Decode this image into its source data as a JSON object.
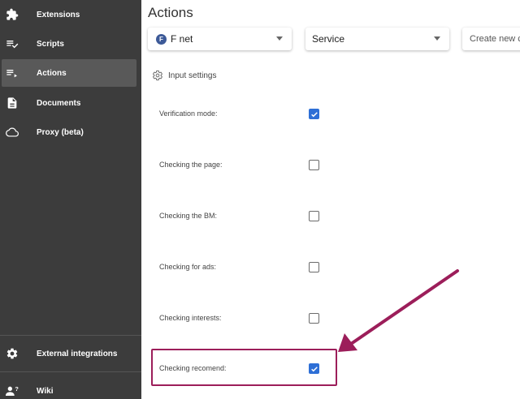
{
  "sidebar": {
    "items": [
      {
        "label": "Extensions",
        "icon": "puzzle-icon"
      },
      {
        "label": "Scripts",
        "icon": "playlist-check-icon"
      },
      {
        "label": "Actions",
        "icon": "playlist-play-icon",
        "active": true
      },
      {
        "label": "Documents",
        "icon": "document-icon"
      },
      {
        "label": "Proxy (beta)",
        "icon": "cloud-icon"
      }
    ],
    "bottom_items": [
      {
        "label": "External integrations",
        "icon": "gear-icon"
      },
      {
        "label": "Wiki",
        "icon": "person-help-icon"
      }
    ]
  },
  "main": {
    "title": "Actions",
    "account_select": {
      "avatar_letter": "F",
      "value": "F net"
    },
    "service_select": {
      "value": "Service"
    },
    "create_input": {
      "placeholder": "Create new c"
    },
    "section_label": "Input settings",
    "settings": [
      {
        "label": "Verification mode:",
        "checked": true
      },
      {
        "label": "Checking the page:",
        "checked": false
      },
      {
        "label": "Checking the BM:",
        "checked": false
      },
      {
        "label": "Checking for ads:",
        "checked": false
      },
      {
        "label": "Checking interests:",
        "checked": false
      },
      {
        "label": "Checking recomend:",
        "checked": true
      }
    ]
  },
  "colors": {
    "sidebar_bg": "#3c3c3c",
    "active_item_bg": "#595959",
    "checkbox_checked": "#2e6fd6",
    "annotation": "#9c1e5a",
    "avatar": "#3d5a98"
  }
}
